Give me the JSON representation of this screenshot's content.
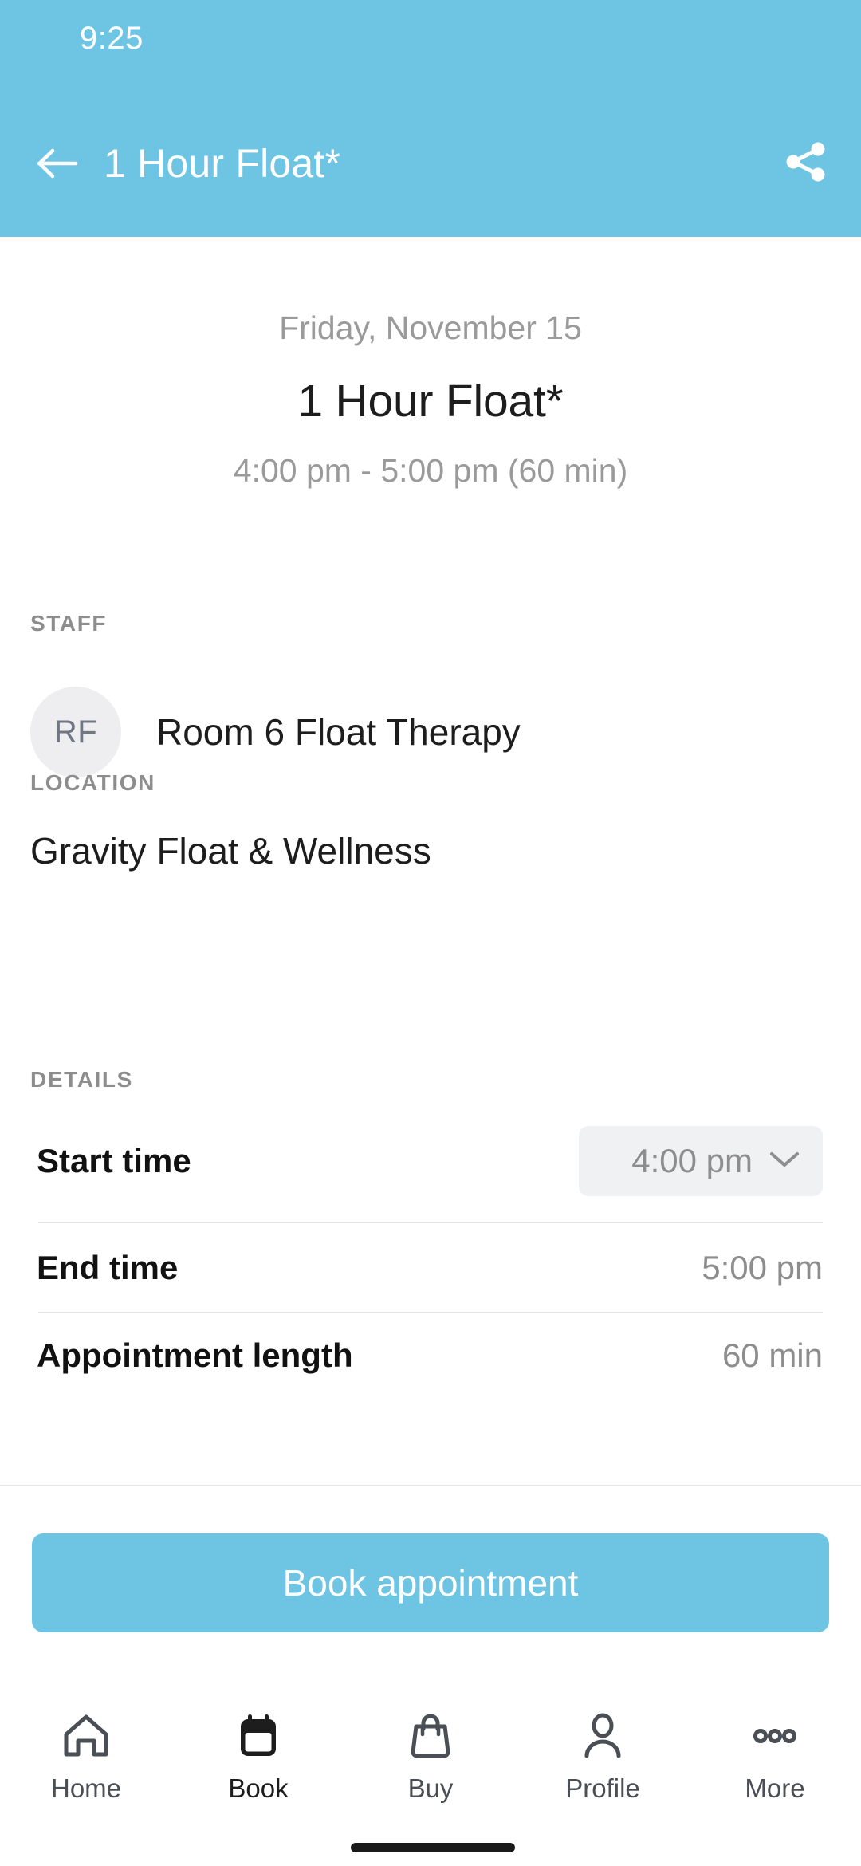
{
  "status_bar": {
    "clock": "9:25"
  },
  "app_bar": {
    "back_icon": "arrow-left-icon",
    "title": "1 Hour Float*",
    "share_icon": "share-icon",
    "background_color": "#6dc5e3"
  },
  "summary": {
    "date": "Friday, November 15",
    "title": "1 Hour Float*",
    "time_range": "4:00 pm - 5:00 pm (60 min)"
  },
  "staff": {
    "section_label": "STAFF",
    "avatar_initials": "RF",
    "name": "Room 6 Float Therapy"
  },
  "location": {
    "section_label": "LOCATION",
    "name": "Gravity Float & Wellness"
  },
  "details": {
    "section_label": "DETAILS",
    "rows": [
      {
        "key": "Start time",
        "value": "4:00 pm",
        "control": "dropdown",
        "chevron_icon": "chevron-down-icon"
      },
      {
        "key": "End time",
        "value": "5:00 pm",
        "control": "text"
      },
      {
        "key": "Appointment length",
        "value": "60 min",
        "control": "text"
      }
    ]
  },
  "primary_action": {
    "label": "Book appointment",
    "color": "#6dc5e3",
    "text_color": "#ffffff"
  },
  "bottom_nav": {
    "items": [
      {
        "label": "Home",
        "icon": "home-icon",
        "active": false
      },
      {
        "label": "Book",
        "icon": "calendar-icon",
        "active": true
      },
      {
        "label": "Buy",
        "icon": "shopping-bag-icon",
        "active": false
      },
      {
        "label": "Profile",
        "icon": "person-icon",
        "active": false
      },
      {
        "label": "More",
        "icon": "ellipsis-icon",
        "active": false
      }
    ]
  }
}
